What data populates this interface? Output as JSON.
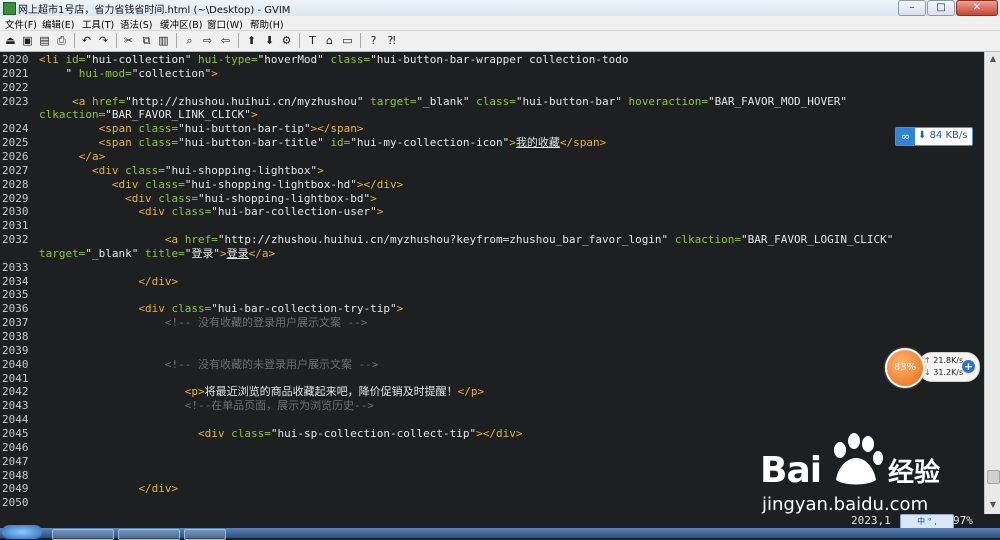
{
  "window": {
    "title": "网上超市1号店，省力省钱省时间.html (~\\Desktop) - GVIM",
    "buttons": [
      "–",
      "□",
      "✕"
    ]
  },
  "menu": [
    "文件(F)",
    "编辑(E)",
    "工具(T)",
    "语法(S)",
    "缓冲区(B)",
    "窗口(W)",
    "帮助(H)"
  ],
  "toolbar_icons": [
    "open-icon",
    "save-icon",
    "save-all-icon",
    "print-icon",
    "undo-icon",
    "redo-icon",
    "cut-icon",
    "copy-icon",
    "paste-icon",
    "find-replace-icon",
    "find-next-icon",
    "find-prev-icon",
    "load-session-icon",
    "save-session-icon",
    "run-script-icon",
    "make-icon",
    "shell-icon",
    "tags-icon",
    "help-icon",
    "find-help-icon"
  ],
  "editor": {
    "lines": [
      {
        "n": "2020",
        "segs": [
          [
            "t",
            "<li "
          ],
          [
            "a",
            "id="
          ],
          [
            "s",
            "\"hui-collection\" "
          ],
          [
            "a",
            "hui-type="
          ],
          [
            "s",
            "\"hoverMod\" "
          ],
          [
            "a",
            "class="
          ],
          [
            "s",
            "\"hui-button-bar-wrapper collection-todo"
          ]
        ]
      },
      {
        "n": "2021",
        "segs": [
          [
            "s",
            "    \" "
          ],
          [
            "a",
            "hui-mod="
          ],
          [
            "s",
            "\"collection\""
          ],
          [
            "t",
            ">"
          ]
        ]
      },
      {
        "n": "2022",
        "segs": []
      },
      {
        "n": "2023",
        "segs": [
          [
            "x",
            "     "
          ],
          [
            "t",
            "<a "
          ],
          [
            "a",
            "href="
          ],
          [
            "s",
            "\"http://zhushou.huihui.cn/myzhushou\" "
          ],
          [
            "a",
            "target="
          ],
          [
            "s",
            "\"_blank\" "
          ],
          [
            "a",
            "class="
          ],
          [
            "s",
            "\"hui-button-bar\" "
          ],
          [
            "a",
            "hoveraction="
          ],
          [
            "s",
            "\"BAR_FAVOR_MOD_HOVER\""
          ]
        ]
      },
      {
        "n": "",
        "segs": [
          [
            "a",
            "clkaction="
          ],
          [
            "s",
            "\"BAR_FAVOR_LINK_CLICK\""
          ],
          [
            "t",
            ">"
          ]
        ]
      },
      {
        "n": "2024",
        "segs": [
          [
            "x",
            "         "
          ],
          [
            "t",
            "<span "
          ],
          [
            "a",
            "class="
          ],
          [
            "s",
            "\"hui-button-bar-tip\""
          ],
          [
            "t",
            "></span>"
          ]
        ]
      },
      {
        "n": "2025",
        "segs": [
          [
            "x",
            "         "
          ],
          [
            "t",
            "<span "
          ],
          [
            "a",
            "class="
          ],
          [
            "s",
            "\"hui-button-bar-title\" "
          ],
          [
            "a",
            "id="
          ],
          [
            "s",
            "\"hui-my-collection-icon\""
          ],
          [
            "t",
            ">"
          ],
          [
            "u",
            "我的收藏"
          ],
          [
            "t",
            "</span>"
          ]
        ]
      },
      {
        "n": "2026",
        "segs": [
          [
            "x",
            "      "
          ],
          [
            "t",
            "</a>"
          ]
        ]
      },
      {
        "n": "2027",
        "segs": [
          [
            "x",
            "        "
          ],
          [
            "t",
            "<div "
          ],
          [
            "a",
            "class="
          ],
          [
            "s",
            "\"hui-shopping-lightbox\""
          ],
          [
            "t",
            ">"
          ]
        ]
      },
      {
        "n": "2028",
        "segs": [
          [
            "x",
            "           "
          ],
          [
            "t",
            "<div "
          ],
          [
            "a",
            "class="
          ],
          [
            "s",
            "\"hui-shopping-lightbox-hd\""
          ],
          [
            "t",
            "></div>"
          ]
        ]
      },
      {
        "n": "2029",
        "segs": [
          [
            "x",
            "             "
          ],
          [
            "t",
            "<div "
          ],
          [
            "a",
            "class="
          ],
          [
            "s",
            "\"hui-shopping-lightbox-bd\""
          ],
          [
            "t",
            ">"
          ]
        ]
      },
      {
        "n": "2030",
        "segs": [
          [
            "x",
            "               "
          ],
          [
            "t",
            "<div "
          ],
          [
            "a",
            "class="
          ],
          [
            "s",
            "\"hui-bar-collection-user\""
          ],
          [
            "t",
            ">"
          ]
        ]
      },
      {
        "n": "2031",
        "segs": []
      },
      {
        "n": "2032",
        "segs": [
          [
            "x",
            "                   "
          ],
          [
            "t",
            "<a "
          ],
          [
            "a",
            "href="
          ],
          [
            "s",
            "\"http://zhushou.huihui.cn/myzhushou?keyfrom=zhushou_bar_favor_login\" "
          ],
          [
            "a",
            "clkaction="
          ],
          [
            "s",
            "\"BAR_FAVOR_LOGIN_CLICK\""
          ]
        ]
      },
      {
        "n": "",
        "segs": [
          [
            "a",
            "target="
          ],
          [
            "s",
            "\"_blank\" "
          ],
          [
            "a",
            "title="
          ],
          [
            "s",
            "\"登录\""
          ],
          [
            "t",
            ">"
          ],
          [
            "u",
            "登录"
          ],
          [
            "t",
            "</a>"
          ]
        ]
      },
      {
        "n": "2033",
        "segs": []
      },
      {
        "n": "2034",
        "segs": [
          [
            "x",
            "               "
          ],
          [
            "t",
            "</div>"
          ]
        ]
      },
      {
        "n": "2035",
        "segs": []
      },
      {
        "n": "2036",
        "segs": [
          [
            "x",
            "               "
          ],
          [
            "t",
            "<div "
          ],
          [
            "a",
            "class="
          ],
          [
            "s",
            "\"hui-bar-collection-try-tip\""
          ],
          [
            "t",
            ">"
          ]
        ]
      },
      {
        "n": "2037",
        "segs": [
          [
            "c",
            "                   <!-- 没有收藏的登录用户展示文案 -->"
          ]
        ]
      },
      {
        "n": "2038",
        "segs": []
      },
      {
        "n": "2039",
        "segs": []
      },
      {
        "n": "2040",
        "segs": [
          [
            "c",
            "                   <!-- 没有收藏的未登录用户展示文案 -->"
          ]
        ]
      },
      {
        "n": "2041",
        "segs": []
      },
      {
        "n": "2042",
        "segs": [
          [
            "x",
            "                      "
          ],
          [
            "t",
            "<p>"
          ],
          [
            "x",
            "将最近浏览的商品收藏起来吧，降价促销及时提醒！"
          ],
          [
            "t",
            "</p>"
          ]
        ]
      },
      {
        "n": "2043",
        "segs": [
          [
            "c",
            "                      <!--在单品页面，展示为浏览历史-->"
          ]
        ]
      },
      {
        "n": "2044",
        "segs": []
      },
      {
        "n": "2045",
        "segs": [
          [
            "x",
            "                        "
          ],
          [
            "t",
            "<div "
          ],
          [
            "a",
            "class="
          ],
          [
            "s",
            "\"hui-sp-collection-collect-tip\""
          ],
          [
            "t",
            "></div>"
          ]
        ]
      },
      {
        "n": "2046",
        "segs": []
      },
      {
        "n": "2047",
        "segs": []
      },
      {
        "n": "2048",
        "segs": []
      },
      {
        "n": "2049",
        "segs": [
          [
            "x",
            "               "
          ],
          [
            "t",
            "</div>"
          ]
        ]
      },
      {
        "n": "2050",
        "segs": []
      }
    ]
  },
  "status": {
    "position": "2023,1",
    "percent": "97%"
  },
  "net_widget": {
    "speed": "84 KB/s"
  },
  "speed_ball": {
    "percent": "83%",
    "up": "21.8K/s",
    "down": "31.2K/s"
  },
  "watermark": {
    "brand": "Bai",
    "brand2": "经验",
    "url": "jingyan.baidu.com"
  },
  "tray": {
    "label": "中 ° , "
  }
}
